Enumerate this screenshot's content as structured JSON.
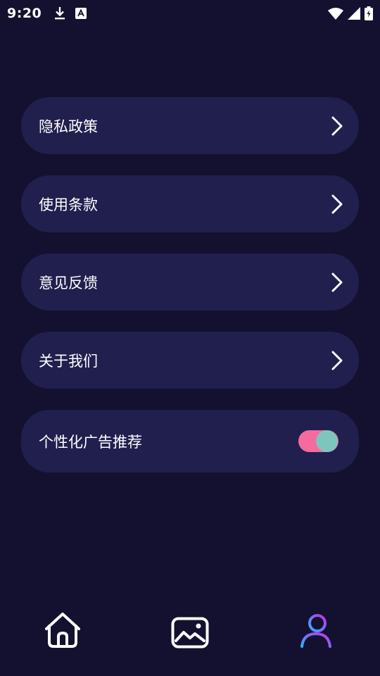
{
  "status_bar": {
    "time": "9:20",
    "left_icons": [
      "download-icon",
      "app-notification-icon"
    ],
    "right_icons": [
      "wifi-icon",
      "signal-icon",
      "battery-charging-icon"
    ]
  },
  "menu": {
    "items": [
      {
        "label": "隐私政策",
        "icon": "chevron-right-icon"
      },
      {
        "label": "使用条款",
        "icon": "chevron-right-icon"
      },
      {
        "label": "意见反馈",
        "icon": "chevron-right-icon"
      },
      {
        "label": "关于我们",
        "icon": "chevron-right-icon"
      }
    ],
    "toggle": {
      "label": "个性化广告推荐",
      "enabled": true
    }
  },
  "bottom_nav": {
    "items": [
      {
        "icon": "home-icon",
        "active": false
      },
      {
        "icon": "gallery-icon",
        "active": false
      },
      {
        "icon": "profile-icon",
        "active": true
      }
    ]
  },
  "colors": {
    "background": "#13112f",
    "card": "#211f4e",
    "toggle_track": "#f56b9f",
    "toggle_knob": "#7ec6bd",
    "active_gradient_start": "#2fb0ff",
    "active_gradient_end": "#c42ee8"
  }
}
